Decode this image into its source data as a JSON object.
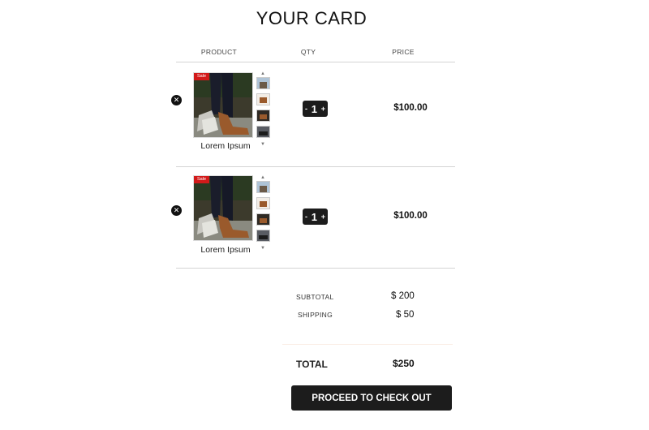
{
  "page": {
    "title": "YOUR CARD"
  },
  "table": {
    "headers": {
      "product": "PRODUCT",
      "qty": "QTY",
      "price": "PRICE"
    }
  },
  "cart": {
    "items": [
      {
        "name": "Lorem Ipsum",
        "badge": "Sale",
        "qty": "1",
        "price": "$100.00",
        "remove_icon": "close-icon",
        "qty_minus": "-",
        "qty_plus": "+"
      },
      {
        "name": "Lorem Ipsum",
        "badge": "Sale",
        "qty": "1",
        "price": "$100.00",
        "remove_icon": "close-icon",
        "qty_minus": "-",
        "qty_plus": "+"
      }
    ]
  },
  "summary": {
    "subtotal_label": "SUBTOTAL",
    "subtotal_value": "$ 200",
    "shipping_label": "SHIPPING",
    "shipping_value": "$ 50",
    "total_label": "TOTAL",
    "total_value": "$250"
  },
  "checkout": {
    "label": "PROCEED TO CHECK OUT"
  },
  "colors": {
    "accent": "#1c1c1c",
    "sale": "#d21a1a"
  }
}
